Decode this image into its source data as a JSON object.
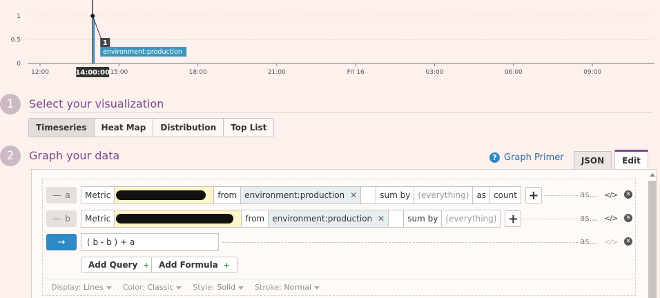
{
  "chart_data": {
    "type": "line",
    "y_ticks": [
      "0",
      "0.5",
      "1"
    ],
    "x_ticks": [
      "12:00",
      "15:00",
      "18:00",
      "21:00",
      "Fri 16",
      "03:00",
      "06:00",
      "09:00"
    ],
    "hover_time": "14:00:00",
    "tooltip_value": "1",
    "tooltip_series": "environment:production",
    "series": [
      {
        "points": [
          {
            "x": "14:00:00",
            "y": 1
          }
        ]
      }
    ],
    "ylim": [
      0,
      1
    ]
  },
  "step1": {
    "number": "1",
    "title": "Select your visualization"
  },
  "vis_tabs": [
    "Timeseries",
    "Heat Map",
    "Distribution",
    "Top List"
  ],
  "step2": {
    "number": "2",
    "title": "Graph your data"
  },
  "graph_primer": "Graph Primer",
  "tabs": {
    "json": "JSON",
    "edit": "Edit"
  },
  "queries": [
    {
      "letter": "a",
      "metric_label": "Metric",
      "from": "from",
      "tag": "environment:production",
      "sum_by": "sum by",
      "everything": "(everything)",
      "as": "as",
      "count": "count",
      "tail": "as..."
    },
    {
      "letter": "b",
      "metric_label": "Metric",
      "from": "from",
      "tag": "environment:production",
      "sum_by": "sum by",
      "everything": "(everything)",
      "tail": "as..."
    }
  ],
  "formula": {
    "arrow": "→",
    "expression": "( b - b ) + a",
    "tail": "as..."
  },
  "buttons": {
    "add_query": "Add Query",
    "add_formula": "Add Formula"
  },
  "display": {
    "display_label": "Display:",
    "display_value": "Lines",
    "color_label": "Color:",
    "color_value": "Classic",
    "style_label": "Style:",
    "style_value": "Solid",
    "stroke_label": "Stroke:",
    "stroke_value": "Normal"
  }
}
